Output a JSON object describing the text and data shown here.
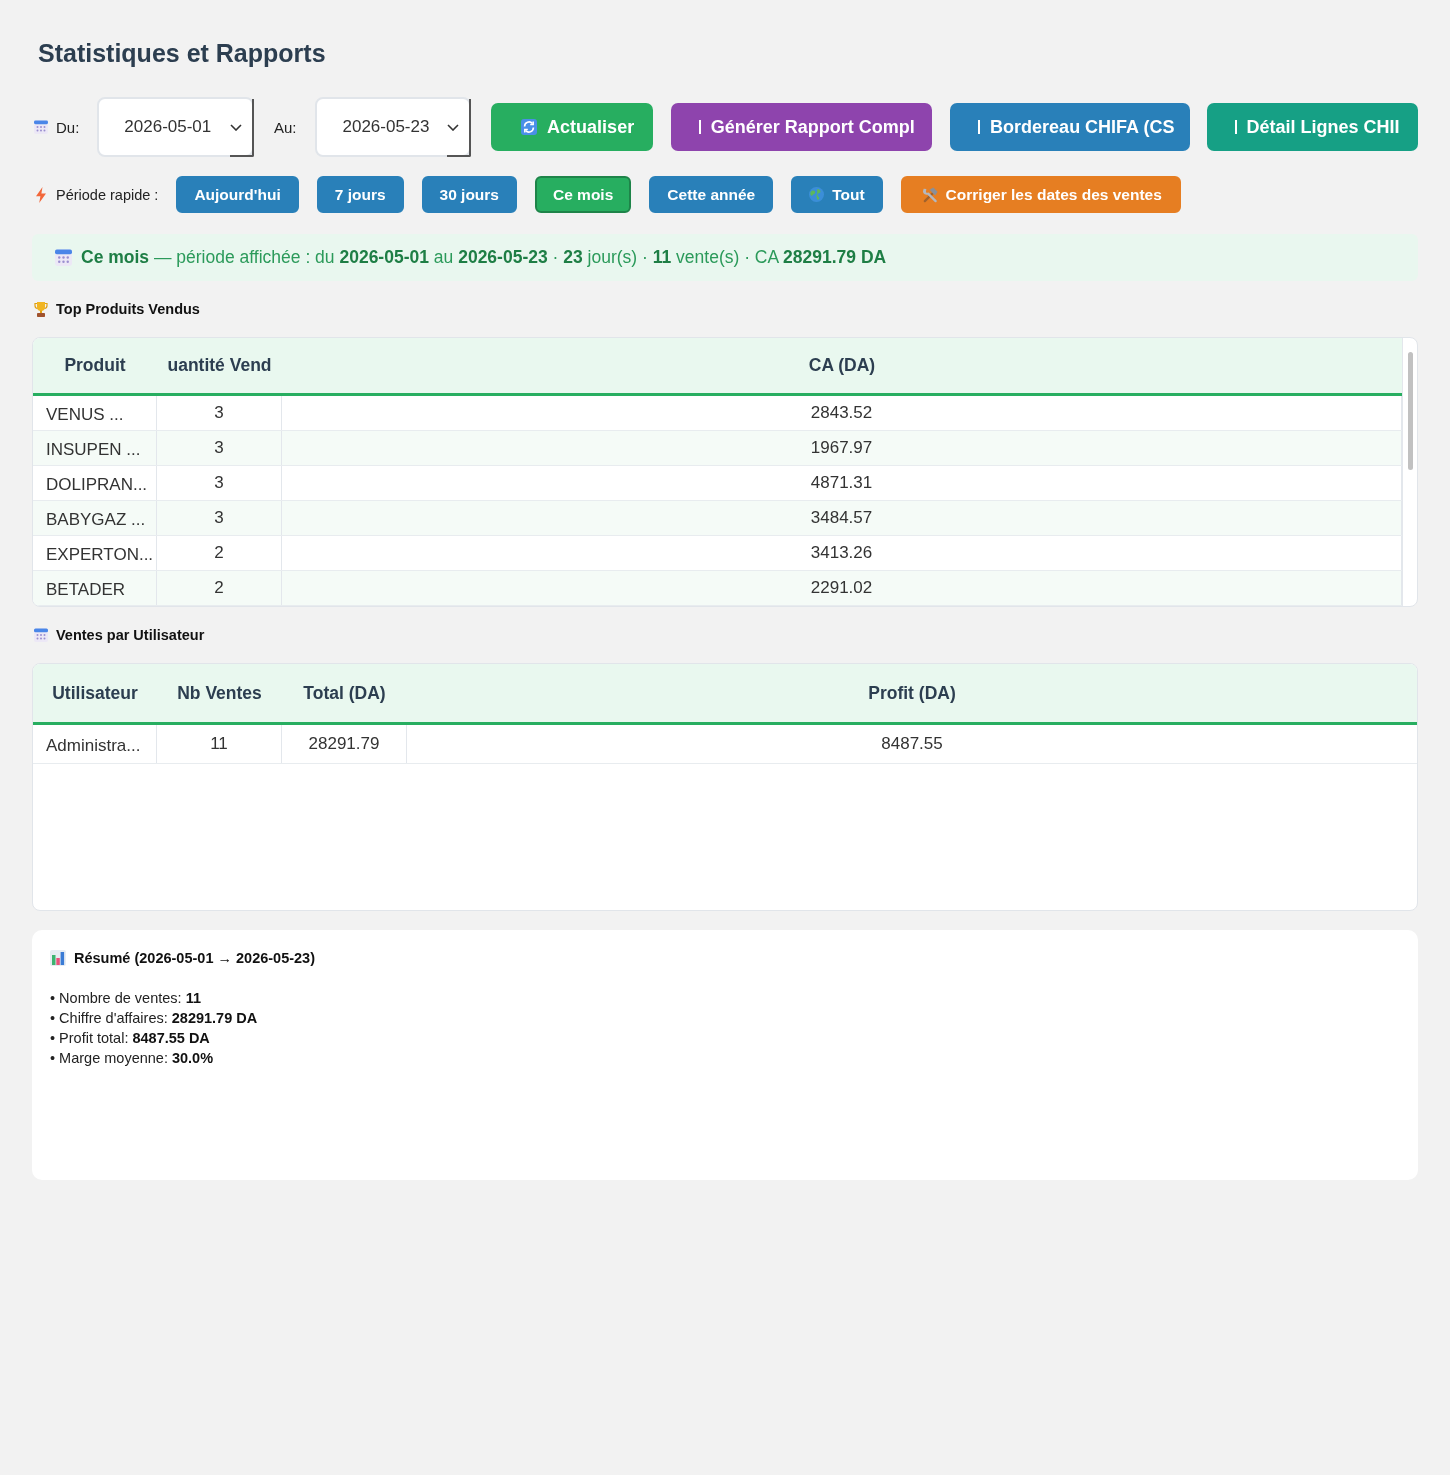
{
  "title": "Statistiques et Rapports",
  "date_range": {
    "from_label": "Du:",
    "from_value": "2026-05-01",
    "to_label": "Au:",
    "to_value": "2026-05-23"
  },
  "actions": [
    {
      "label": "Actualiser",
      "kind": "refresh",
      "color": "#27ae60"
    },
    {
      "label": "Générer Rapport Compl",
      "kind": "glyph",
      "color": "#8e44ad"
    },
    {
      "label": "Bordereau CHIFA (CS",
      "kind": "glyph",
      "color": "#2980b9"
    },
    {
      "label": "Détail Lignes CHII",
      "kind": "glyph",
      "color": "#16a085"
    }
  ],
  "quick_period": {
    "label": "Période rapide :",
    "options": [
      {
        "label": "Aujourd'hui",
        "kind": "plain",
        "selected": false
      },
      {
        "label": "7 jours",
        "kind": "plain",
        "selected": false
      },
      {
        "label": "30 jours",
        "kind": "plain",
        "selected": false
      },
      {
        "label": "Ce mois",
        "kind": "plain",
        "selected": true
      },
      {
        "label": "Cette année",
        "kind": "plain",
        "selected": false
      },
      {
        "label": "Tout",
        "kind": "globe",
        "selected": false
      }
    ]
  },
  "fix_dates_button": {
    "label": "Corriger les dates des ventes"
  },
  "banner": {
    "text": "**Ce mois** — période affichée : du **2026-05-01** au **2026-05-23** · **23** jour(s) · **11** vente(s) · CA **28291.79 DA**"
  },
  "top_products": {
    "title": "Top Produits Vendus",
    "columns": [
      "Produit",
      "uantité Vend",
      "CA (DA)"
    ],
    "rows": [
      [
        "VENUS ...",
        "3",
        "2843.52"
      ],
      [
        "INSUPEN ...",
        "3",
        "1967.97"
      ],
      [
        "DOLIPRAN...",
        "3",
        "4871.31"
      ],
      [
        "BABYGAZ ...",
        "3",
        "3484.57"
      ],
      [
        "EXPERTON...",
        "2",
        "3413.26"
      ],
      [
        "BETADER",
        "2",
        "2291.02"
      ]
    ]
  },
  "sales_by_user": {
    "title": "Ventes par Utilisateur",
    "columns": [
      "Utilisateur",
      "Nb Ventes",
      "Total (DA)",
      "Profit (DA)"
    ],
    "rows": [
      [
        "Administra...",
        "11",
        "28291.79",
        "8487.55"
      ]
    ]
  },
  "summary": {
    "title": "Résumé (2026-05-01 → 2026-05-23)",
    "lines": [
      "• Nombre de ventes: **11**",
      "• Chiffre d'affaires: **28291.79 DA**",
      "• Profit total: **8487.55 DA**",
      "• Marge moyenne: **30.0%**"
    ]
  }
}
